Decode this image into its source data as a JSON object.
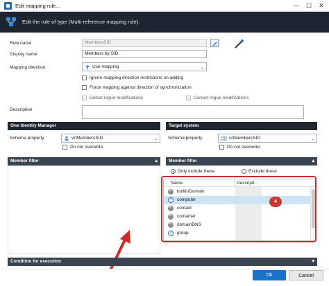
{
  "window": {
    "title": "Edit mapping rule...",
    "minimize_glyph": "—",
    "maximize_glyph": "☐",
    "close_glyph": "✕"
  },
  "header": {
    "text": "Edit the rule of type (Multi-reference mapping rule)."
  },
  "form": {
    "rule_name_label": "Rule name",
    "rule_name_value": "MembersSID",
    "display_name_label": "Display name",
    "display_name_value": "Members by SID",
    "mapping_direction_label": "Mapping direction",
    "mapping_direction_value": "Use mapping",
    "ignore_restrictions": "Ignore mapping direction restrictions on adding",
    "force_mapping": "Force mapping against direction of synchronization",
    "detect_rogue": "Detect rogue modifications",
    "correct_rogue": "Correct rogue modifications",
    "description_label": "Description",
    "description_value": ""
  },
  "left_section": {
    "title": "One Identity Manager",
    "schema_property_label": "Schema property",
    "schema_property_value": "vrtMembersSID",
    "do_not_overwrite": "Do not overwrite",
    "member_filter_title": "Member filter"
  },
  "right_section": {
    "title": "Target system",
    "schema_property_label": "Schema property",
    "schema_property_value": "vrtMembersSID",
    "do_not_overwrite": "Do not overwrite",
    "member_filter_title": "Member filter",
    "radio_include": "Only include these",
    "radio_exclude": "Exclude these",
    "grid": {
      "col_name": "Name",
      "col_description": "Descripti...",
      "rows": [
        {
          "name": "builtinDomain",
          "state": "excluded"
        },
        {
          "name": "computer",
          "state": "included"
        },
        {
          "name": "contact",
          "state": "excluded"
        },
        {
          "name": "container",
          "state": "excluded"
        },
        {
          "name": "domainDNS",
          "state": "excluded"
        },
        {
          "name": "group",
          "state": "included"
        }
      ]
    }
  },
  "annotation": {
    "badge": "4"
  },
  "condition_section": {
    "title": "Condition for execution"
  },
  "footer": {
    "ok": "Ok",
    "cancel": "Cancel"
  },
  "colors": {
    "header_bg": "#1e2530",
    "accent": "#1a73c8",
    "highlight": "#d12a2a"
  }
}
